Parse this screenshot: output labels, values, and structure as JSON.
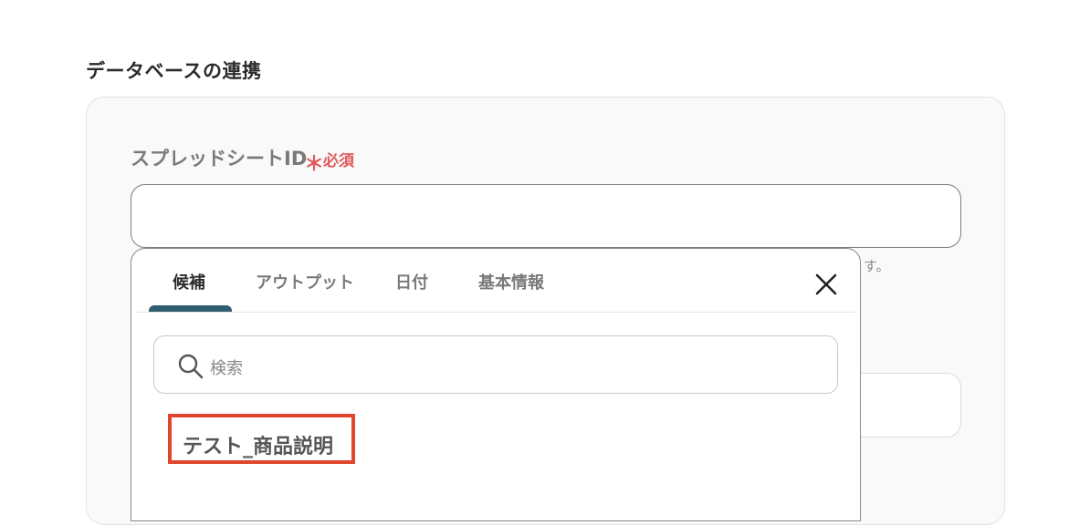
{
  "section": {
    "title": "データベースの連携"
  },
  "field": {
    "label": "スプレッドシートID",
    "required_mark": "＊",
    "required_text": "必須",
    "hint_tail": "す。"
  },
  "popup": {
    "tabs": [
      {
        "label": "候補",
        "active": true
      },
      {
        "label": "アウトプット",
        "active": false
      },
      {
        "label": "日付",
        "active": false
      },
      {
        "label": "基本情報",
        "active": false
      }
    ],
    "search": {
      "placeholder": "検索",
      "icon": "search-icon"
    },
    "close_icon": "close-icon",
    "candidates": [
      {
        "label": "テスト_商品説明"
      }
    ],
    "accent_color": "#2e5e70",
    "highlight_color": "#e0452e"
  }
}
